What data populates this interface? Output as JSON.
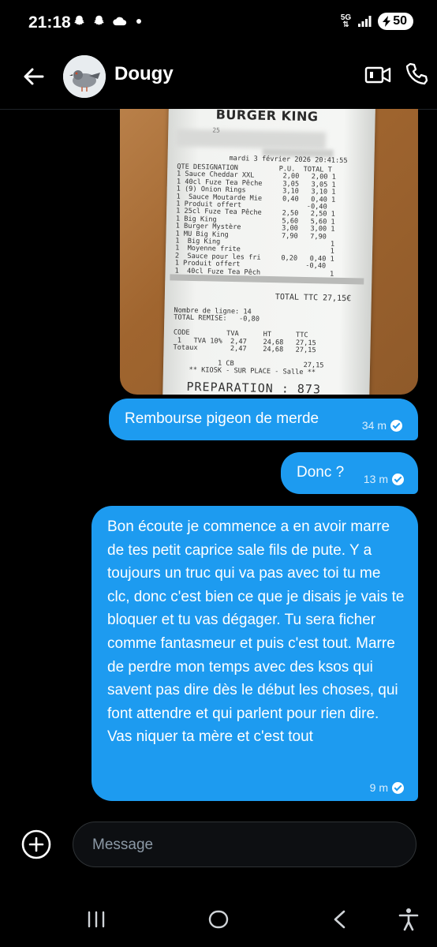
{
  "status_bar": {
    "time": "21:18",
    "network": "5G",
    "battery": "50",
    "left_icons": [
      "snapchat-icon",
      "snapchat-icon",
      "cloud-icon",
      "dot-icon"
    ],
    "right_icons": [
      "5g-data-icon",
      "signal-icon",
      "battery-icon"
    ]
  },
  "header": {
    "contact_name": "Dougy",
    "icons": [
      "back-arrow-icon",
      "video-call-icon",
      "phone-call-icon"
    ]
  },
  "receipt": {
    "brand": "BURGER KING",
    "store_number": "25",
    "date_line": "mardi 3 février 2026 20:41:55",
    "items_text": "QTE DESIGNATION          P.U.  TOTAL T\n1 Sauce Cheddar XXL       2,00   2,00 1\n1 40cl Fuze Tea Pêche     3,05   3,05 1\n1 (9) Onion Rings         3,10   3,10 1\n1  Sauce Moutarde Mie     0,40   0,40 1\n1 Produit offert                -0,40\n1 25cl Fuze Tea Pêche     2,50   2,50 1\n1 Big King                5,60   5,60 1\n1 Burger Mystère          3,00   3,00 1\n1 MU Big King             7,90   7,90\n1  Big King                           1\n1  Moyenne frite                      1\n2  Sauce pour les fri     0,20   0,40 1\n1 Produit offert                -0,40\n1  40cl Fuze Tea Pêch                 1",
    "total_line": "TOTAL TTC    27,15€",
    "summary_text": "Nombre de ligne: 14\nTOTAL REMISE:   -0,80\n\nCODE         TVA      HT      TTC\n 1   TVA 10%  2,47    24,68   27,15\nTotaux        2,47    24,68   27,15\n\n           1 CB                 27,15\n    ** KIOSK - SUR PLACE - Salle **",
    "preparation": "PREPARATION : 873"
  },
  "messages": [
    {
      "text": "Rembourse pigeon de merde",
      "time": "34 m"
    },
    {
      "text": "Donc ?",
      "time": "13 m"
    },
    {
      "text": "Bon écoute je commence a en avoir marre de tes petit caprice sale fils de pute. Y a toujours un truc qui va pas avec toi tu me clc, donc c'est bien ce que je disais je vais te bloquer et tu vas dégager. Tu sera ficher comme fantasmeur et puis c'est tout. Marre de perdre mon temps avec des ksos qui savent pas dire dès le début les choses, qui font attendre et qui parlent pour rien dire. Vas niquer ta mère et c'est tout",
      "time": "9 m"
    }
  ],
  "composer": {
    "placeholder": "Message",
    "add_icon": "add-circle-icon"
  },
  "nav_bar": {
    "icons": [
      "recent-apps-icon",
      "home-icon",
      "back-icon",
      "accessibility-icon"
    ]
  },
  "colors": {
    "background": "#000000",
    "bubble": "#1d9bf0",
    "muted_text": "#8b98a5"
  }
}
